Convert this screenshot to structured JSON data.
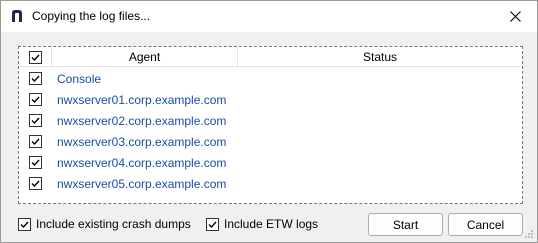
{
  "window": {
    "title": "Copying the log files..."
  },
  "grid": {
    "columns": {
      "agent": "Agent",
      "status": "Status"
    },
    "header_checked": true,
    "rows": [
      {
        "agent": "Console",
        "status": "",
        "checked": true
      },
      {
        "agent": "nwxserver01.corp.example.com",
        "status": "",
        "checked": true
      },
      {
        "agent": "nwxserver02.corp.example.com",
        "status": "",
        "checked": true
      },
      {
        "agent": "nwxserver03.corp.example.com",
        "status": "",
        "checked": true
      },
      {
        "agent": "nwxserver04.corp.example.com",
        "status": "",
        "checked": true
      },
      {
        "agent": "nwxserver05.corp.example.com",
        "status": "",
        "checked": true
      }
    ]
  },
  "options": {
    "crash_dumps_label": "Include existing crash dumps",
    "crash_dumps_checked": true,
    "etw_logs_label": "Include ETW logs",
    "etw_logs_checked": true
  },
  "buttons": {
    "start": "Start",
    "cancel": "Cancel"
  },
  "colors": {
    "agent_link": "#1a4da6",
    "accent": "#000000"
  },
  "icons": {
    "app": "app-logo-icon",
    "close": "close-icon",
    "check": "checkmark-icon",
    "grip": "resize-grip-icon"
  }
}
